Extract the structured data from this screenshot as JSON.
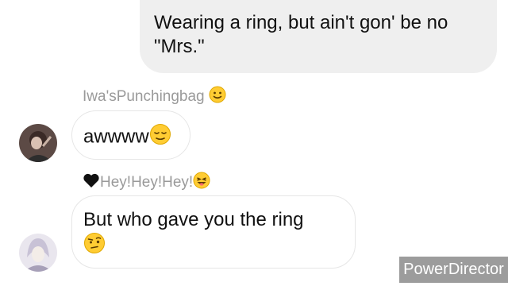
{
  "messages": {
    "outgoing": {
      "text_line1": "Wearing a ring, but ain't gon' be no",
      "text_line2": "\"Mrs.\""
    },
    "incoming_1": {
      "sender": "Iwa'sPunchingbag",
      "sender_emoji": "slightly-smiling-face-icon",
      "text": "awwww",
      "text_emoji": "relieved-face-icon"
    },
    "incoming_2": {
      "sender_prefix_emoji": "black-heart-icon",
      "sender": "Hey!Hey!Hey!",
      "sender_emoji": "winking-tongue-face-icon",
      "text_line1": "But who gave you the ring",
      "text_emoji": "raised-eyebrow-face-icon"
    }
  },
  "watermark": {
    "text": "PowerDirector"
  },
  "colors": {
    "outgoing_bubble": "#efefef",
    "incoming_border": "#e6e6e6",
    "sender_text": "#9a9a9a",
    "watermark_bg": "#9c9c9c"
  }
}
